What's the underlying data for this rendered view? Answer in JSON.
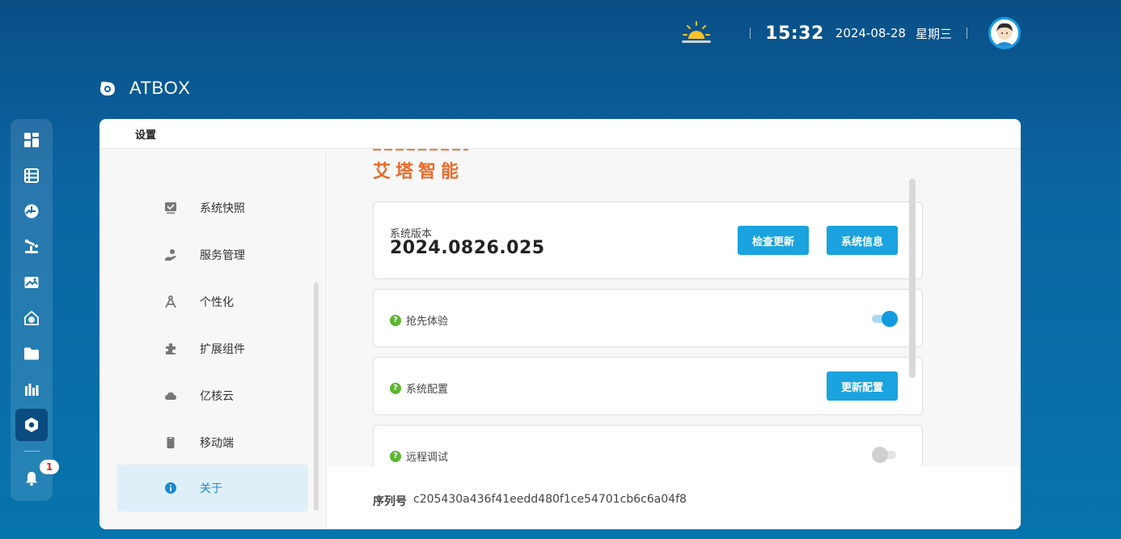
{
  "topbar": {
    "time": "15:32",
    "date": "2024-08-28",
    "weekday": "星期三",
    "weather_icon": "sunrise-icon"
  },
  "brand": {
    "name": "ATBOX"
  },
  "rail": {
    "items": [
      "dashboard-icon",
      "list-icon",
      "monitor-icon",
      "robot-arm-icon",
      "image-icon",
      "home-icon",
      "folder-icon",
      "chart-icon",
      "settings-icon",
      "bell-icon"
    ],
    "notifications": "1"
  },
  "window": {
    "title": "设置"
  },
  "nav": {
    "items": [
      {
        "label": "系统快照",
        "icon": "snapshot-icon"
      },
      {
        "label": "服务管理",
        "icon": "service-icon"
      },
      {
        "label": "个性化",
        "icon": "compass-icon"
      },
      {
        "label": "扩展组件",
        "icon": "puzzle-icon"
      },
      {
        "label": "亿核云",
        "icon": "cloud-icon"
      },
      {
        "label": "移动端",
        "icon": "mobile-icon"
      },
      {
        "label": "关于",
        "icon": "info-icon"
      }
    ],
    "active": "关于"
  },
  "about": {
    "logo_text": "艾塔智能",
    "version_label": "系统版本",
    "version": "2024.0826.025",
    "check_update": "检查更新",
    "system_info": "系统信息",
    "early_access": "抢先体验",
    "early_access_on": true,
    "system_config": "系统配置",
    "update_config": "更新配置",
    "remote_debug": "远程调试",
    "remote_debug_on": false,
    "serial_label": "序列号",
    "serial": "c205430a436f41eedd480f1ce54701cb6c6a04f8"
  },
  "colors": {
    "accent": "#1aa3de",
    "brand_orange": "#ea6a2b",
    "help_green": "#5cb531"
  }
}
